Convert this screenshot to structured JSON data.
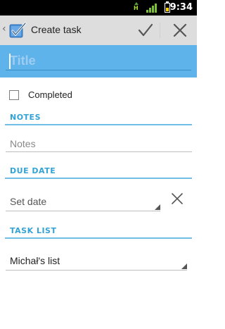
{
  "status_bar": {
    "time": "9:34",
    "network_type": "H",
    "icons": [
      "network-type-icon",
      "signal-icon",
      "battery-icon"
    ],
    "battery_color": "#ffd400"
  },
  "action_bar": {
    "title": "Create task",
    "icons": [
      "up-caret-icon",
      "app-checkbox-icon",
      "checkmark-icon",
      "close-icon"
    ]
  },
  "form": {
    "title_placeholder": "Title",
    "title_value": "",
    "completed_label": "Completed",
    "notes_header": "NOTES",
    "notes_placeholder": "Notes",
    "due_date_header": "DUE DATE",
    "due_date_value": "Set date",
    "task_list_header": "TASK LIST",
    "task_list_value": "Michał's list"
  },
  "colors": {
    "accent": "#5eb3eb",
    "section_header": "#33a3d6",
    "action_bar_bg": "#dddddd"
  }
}
